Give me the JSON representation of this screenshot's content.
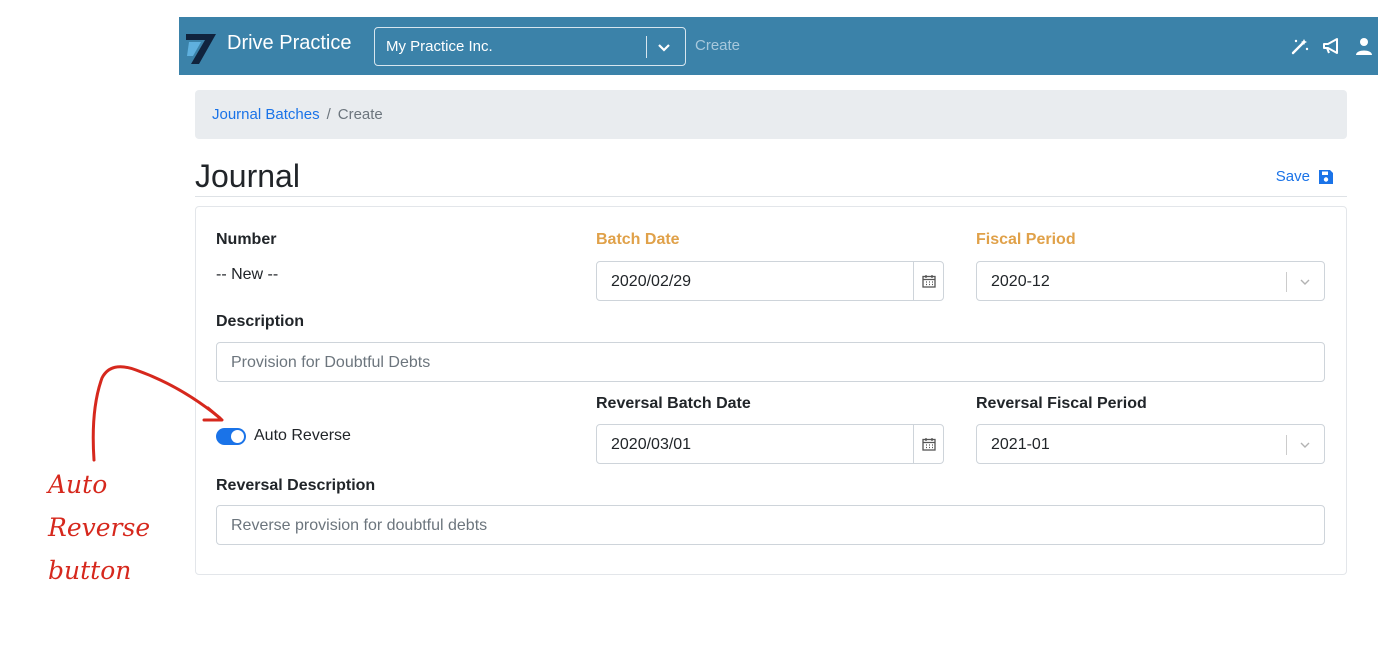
{
  "app": {
    "brand_name": "Drive Practice",
    "company": "My Practice Inc.",
    "nav_context": "Create",
    "nav_icons": [
      "magic-wand-icon",
      "megaphone-icon",
      "user-icon"
    ],
    "accent_color": "#3b82a9"
  },
  "breadcrumb": {
    "parent": "Journal Batches",
    "separator": "/",
    "current": "Create"
  },
  "page": {
    "title": "Journal",
    "save_label": "Save"
  },
  "form": {
    "number_label": "Number",
    "number_value": "-- New --",
    "batch_date_label": "Batch Date",
    "batch_date_value": "2020/02/29",
    "fiscal_period_label": "Fiscal Period",
    "fiscal_period_value": "2020-12",
    "description_label": "Description",
    "description_value": "Provision for Doubtful Debts",
    "auto_reverse_label": "Auto Reverse",
    "auto_reverse_on": true,
    "reversal_batch_date_label": "Reversal Batch Date",
    "reversal_batch_date_value": "2020/03/01",
    "reversal_fiscal_period_label": "Reversal Fiscal Period",
    "reversal_fiscal_period_value": "2021-01",
    "reversal_description_label": "Reversal Description",
    "reversal_description_value": "Reverse provision for doubtful debts",
    "required_label_color": "#e0a149"
  },
  "annotation": {
    "lines": [
      "Auto",
      "Reverse",
      "button"
    ],
    "color": "#d6281d"
  }
}
